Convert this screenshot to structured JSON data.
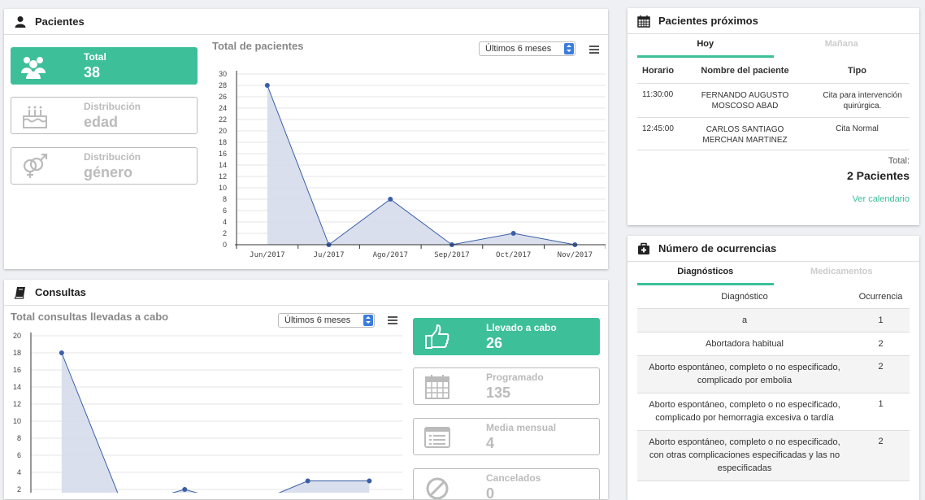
{
  "pacientes": {
    "title": "Pacientes",
    "stats": [
      {
        "label": "Total",
        "value": "38",
        "icon": "users-icon"
      },
      {
        "label": "Distribución",
        "value": "edad",
        "icon": "cake-icon"
      },
      {
        "label": "Distribución",
        "value": "género",
        "icon": "gender-icon"
      }
    ],
    "chart_title": "Total de pacientes",
    "range_select": "Últimos 6 meses"
  },
  "consultas": {
    "title": "Consultas",
    "chart_title": "Total consultas llevadas a cabo",
    "range_select": "Últimos 6 meses",
    "stats": [
      {
        "label": "Llevado a cabo",
        "value": "26",
        "icon": "thumbs-up-icon"
      },
      {
        "label": "Programado",
        "value": "135",
        "icon": "calendar-icon"
      },
      {
        "label": "Media mensual",
        "value": "4",
        "icon": "list-icon"
      },
      {
        "label": "Cancelados",
        "value": "0",
        "icon": "ban-icon"
      }
    ]
  },
  "proximos": {
    "title": "Pacientes próximos",
    "tabs": [
      "Hoy",
      "Mañana"
    ],
    "headers": [
      "Horario",
      "Nombre del paciente",
      "Tipo"
    ],
    "rows": [
      {
        "time": "11:30:00",
        "name": "FERNANDO AUGUSTO MOSCOSO ABAD",
        "type": "Cita para intervención quirúrgica."
      },
      {
        "time": "12:45:00",
        "name": "CARLOS SANTIAGO MERCHAN MARTINEZ",
        "type": "Cita Normal"
      }
    ],
    "total_label": "Total:",
    "total_value": "2 Pacientes",
    "link": "Ver calendario"
  },
  "ocurrencias": {
    "title": "Número de ocurrencias",
    "tabs": [
      "Diagnósticos",
      "Medicamentos"
    ],
    "headers": [
      "Diagnóstico",
      "Ocurrencia"
    ],
    "rows": [
      {
        "name": "a",
        "count": "1"
      },
      {
        "name": "Abortadora habitual",
        "count": "2"
      },
      {
        "name": "Aborto espontáneo, completo o no especificado, complicado por embolia",
        "count": "2"
      },
      {
        "name": "Aborto espontáneo, completo o no especificado, complicado por hemorragia excesiva o tardía",
        "count": "1"
      },
      {
        "name": "Aborto espontáneo, completo o no especificado, con otras complicaciones especificadas y las no especificadas",
        "count": "2"
      }
    ]
  },
  "colors": {
    "accent": "#3dbf9a",
    "series": "#3a5ea8",
    "fill": "#d5dcea",
    "select": "#3b7ddd"
  },
  "chart_data": [
    {
      "type": "area",
      "title": "Total de pacientes",
      "categories": [
        "Jun/2017",
        "Ju/2017",
        "Ago/2017",
        "Sep/2017",
        "Oct/2017",
        "Nov/2017"
      ],
      "values": [
        28,
        0,
        8,
        0,
        2,
        0
      ],
      "yticks": [
        "0",
        "2",
        "4",
        "6",
        "8",
        "10",
        "12",
        "14",
        "16",
        "18",
        "20",
        "22",
        "24",
        "26",
        "28",
        "30"
      ],
      "ylim": [
        0,
        30
      ]
    },
    {
      "type": "area",
      "title": "Total consultas llevadas a cabo",
      "values": [
        18,
        0,
        2,
        0,
        3,
        3
      ],
      "yticks": [
        "2",
        "4",
        "6",
        "8",
        "10",
        "12",
        "14",
        "16",
        "18",
        "20"
      ],
      "ylim": [
        0,
        20
      ]
    }
  ]
}
